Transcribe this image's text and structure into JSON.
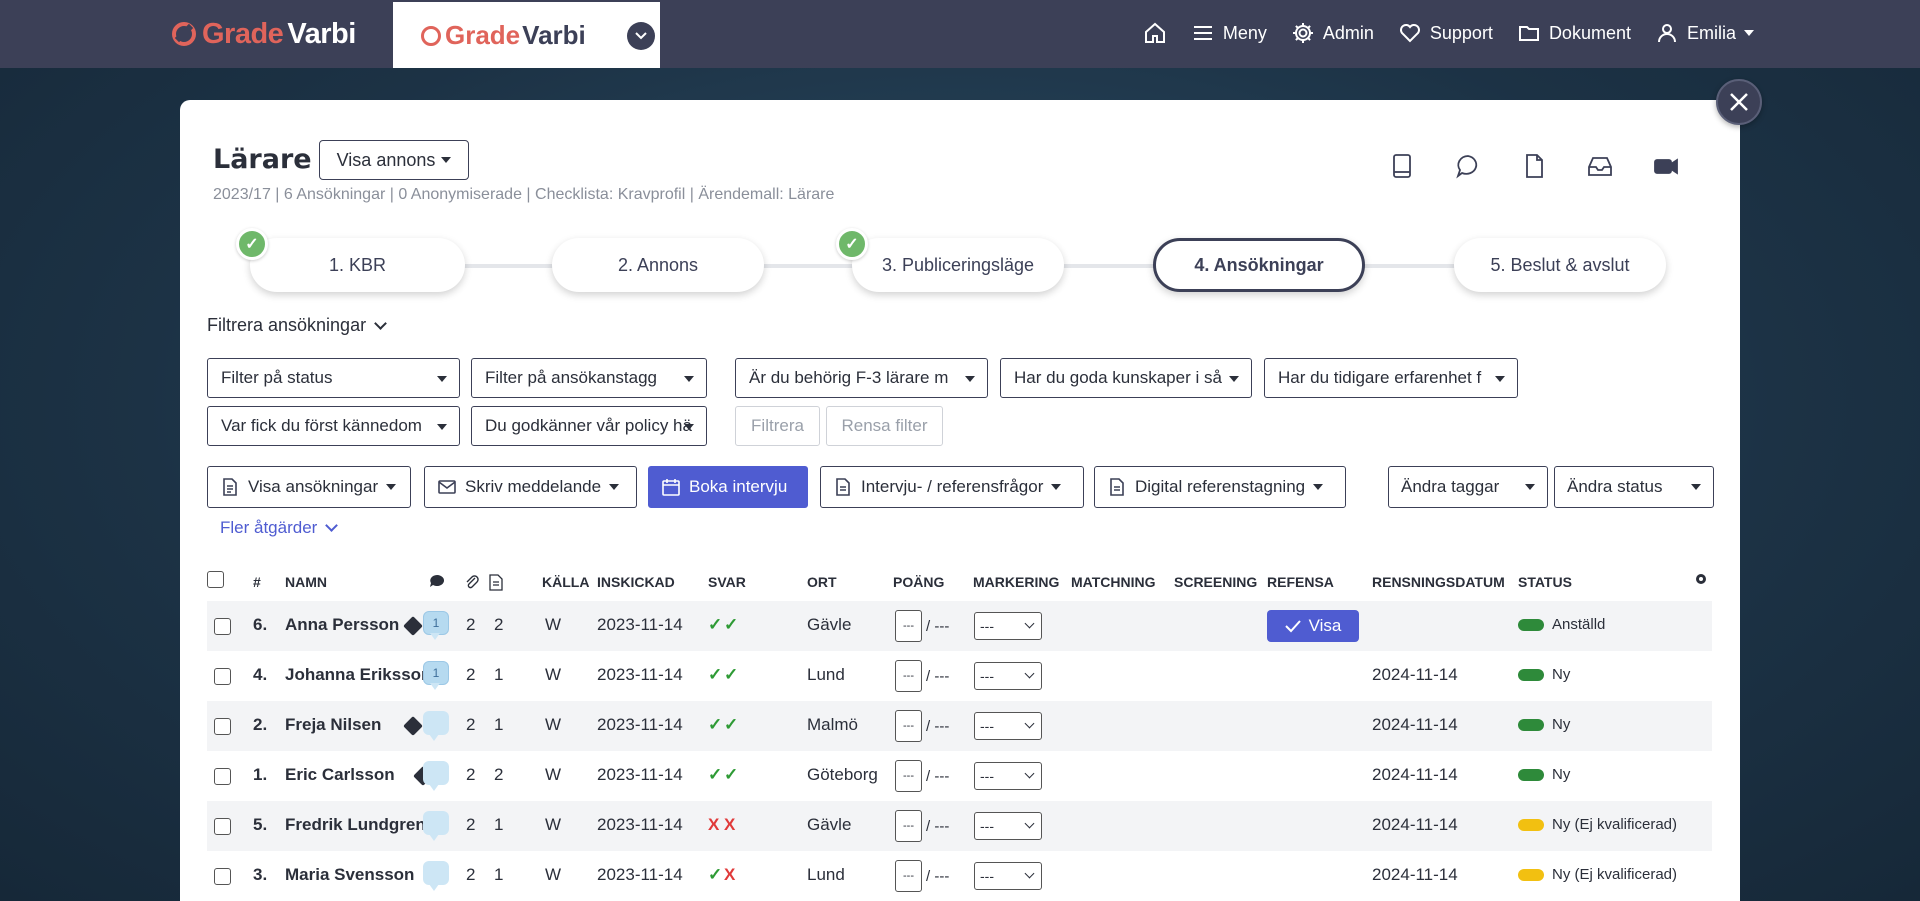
{
  "app": {
    "brand_part1": "Grade",
    "brand_part2": "Varbi",
    "switcher_part1": "Grade",
    "switcher_part2": "Varbi"
  },
  "nav": {
    "items": [
      {
        "label": "",
        "icon": "home-icon"
      },
      {
        "label": "Meny",
        "icon": "menu-icon"
      },
      {
        "label": "Admin",
        "icon": "gear-icon"
      },
      {
        "label": "Support",
        "icon": "heart-icon"
      },
      {
        "label": "Dokument",
        "icon": "folder-icon"
      },
      {
        "label": "Emilia",
        "icon": "user-icon"
      }
    ]
  },
  "header": {
    "title": "Lärare",
    "visa_annons": "Visa annons",
    "subtitle": "2023/17 | 6 Ansökningar | 0 Anonymiserade | Checklista: Kravprofil | Ärendemall: Lärare"
  },
  "steps": [
    {
      "label": "1. KBR",
      "done": true
    },
    {
      "label": "2. Annons",
      "done": false
    },
    {
      "label": "3. Publiceringsläge",
      "done": true
    },
    {
      "label": "4. Ansökningar",
      "active": true
    },
    {
      "label": "5. Beslut & avslut",
      "done": false
    }
  ],
  "filters": {
    "toggle_label": "Filtrera ansökningar",
    "row1": [
      "Filter på status",
      "Filter på ansökanstagg",
      "Är du behörig F-3 lärare m",
      "Har du goda kunskaper i så",
      "Har du tidigare erfarenhet f"
    ],
    "row2": [
      "Var fick du först kännedom",
      "Du godkänner vår policy hä"
    ],
    "filtrera": "Filtrera",
    "rensa": "Rensa filter"
  },
  "actions": {
    "visa_ansokningar": "Visa ansökningar",
    "skriv_meddelande": "Skriv meddelande",
    "boka_intervju": "Boka intervju",
    "intervju_fragor": "Intervju- / referensfrågor",
    "digital_ref": "Digital referenstagning",
    "andra_taggar": "Ändra taggar",
    "andra_status": "Ändra status",
    "fler": "Fler åtgärder"
  },
  "table": {
    "headers": {
      "num": "#",
      "name": "NAMN",
      "kalla": "KÄLLA",
      "inskickad": "INSKICKAD",
      "svar": "SVAR",
      "ort": "ORT",
      "poang": "POÄNG",
      "markering": "MARKERING",
      "matchning": "MATCHNING",
      "screening": "SCREENING",
      "refensa": "REFENSA",
      "rensningsdatum": "RENSNINGSDATUM",
      "status": "STATUS"
    },
    "rows": [
      {
        "num": "6.",
        "name": "Anna Persson",
        "tag": true,
        "msgs": "1",
        "attach": "2",
        "docs": "2",
        "kalla": "W",
        "date": "2023-11-14",
        "svar1": "✓",
        "svar2": "✓",
        "svar1_ok": true,
        "svar2_ok": true,
        "ort": "Gävle",
        "pts": "---",
        "pts_max": "/ ---",
        "mark": "---",
        "refensa": "Visa",
        "rdate": "",
        "status": "Anställd",
        "status_color": "#2e8a3a"
      },
      {
        "num": "4.",
        "name": "Johanna Eriksson",
        "tag": false,
        "msgs": "1",
        "attach": "2",
        "docs": "1",
        "kalla": "W",
        "date": "2023-11-14",
        "svar1": "✓",
        "svar2": "✓",
        "svar1_ok": true,
        "svar2_ok": true,
        "ort": "Lund",
        "pts": "---",
        "pts_max": "/ ---",
        "mark": "---",
        "refensa": "",
        "rdate": "2024-11-14",
        "status": "Ny",
        "status_color": "#2e8a3a"
      },
      {
        "num": "2.",
        "name": "Freja Nilsen",
        "tag": true,
        "msgs": "",
        "attach": "2",
        "docs": "1",
        "kalla": "W",
        "date": "2023-11-14",
        "svar1": "✓",
        "svar2": "✓",
        "svar1_ok": true,
        "svar2_ok": true,
        "ort": "Malmö",
        "pts": "---",
        "pts_max": "/ ---",
        "mark": "---",
        "refensa": "",
        "rdate": "2024-11-14",
        "status": "Ny",
        "status_color": "#2e8a3a"
      },
      {
        "num": "1.",
        "name": "Eric Carlsson",
        "tag": true,
        "msgs": "",
        "attach": "2",
        "docs": "2",
        "kalla": "W",
        "date": "2023-11-14",
        "svar1": "✓",
        "svar2": "✓",
        "svar1_ok": true,
        "svar2_ok": true,
        "ort": "Göteborg",
        "pts": "---",
        "pts_max": "/ ---",
        "mark": "---",
        "refensa": "",
        "rdate": "2024-11-14",
        "status": "Ny",
        "status_color": "#2e8a3a"
      },
      {
        "num": "5.",
        "name": "Fredrik Lundgren",
        "tag": false,
        "msgs": "",
        "attach": "2",
        "docs": "1",
        "kalla": "W",
        "date": "2023-11-14",
        "svar1": "X",
        "svar2": "X",
        "svar1_ok": false,
        "svar2_ok": false,
        "ort": "Gävle",
        "pts": "---",
        "pts_max": "/ ---",
        "mark": "---",
        "refensa": "",
        "rdate": "2024-11-14",
        "status": "Ny (Ej kvalificerad)",
        "status_color": "#f2c011"
      },
      {
        "num": "3.",
        "name": "Maria Svensson",
        "tag": false,
        "msgs": "",
        "attach": "2",
        "docs": "1",
        "kalla": "W",
        "date": "2023-11-14",
        "svar1": "✓",
        "svar2": "X",
        "svar1_ok": true,
        "svar2_ok": false,
        "ort": "Lund",
        "pts": "---",
        "pts_max": "/ ---",
        "mark": "---",
        "refensa": "",
        "rdate": "2024-11-14",
        "status": "Ny (Ej kvalificerad)",
        "status_color": "#f2c011"
      }
    ]
  }
}
